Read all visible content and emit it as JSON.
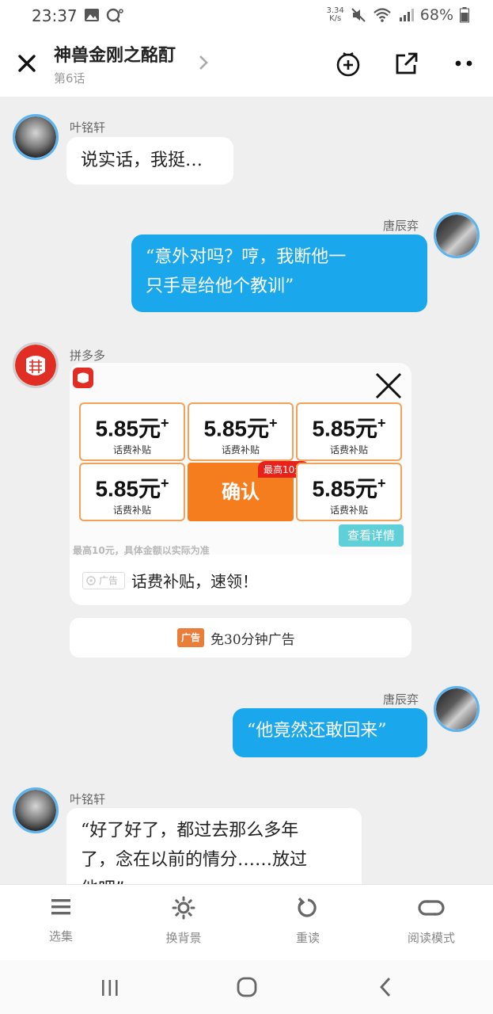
{
  "status_bar": {
    "time": "23:37",
    "speed_top": "3.34",
    "speed_bottom": "K/s",
    "battery": "68%"
  },
  "nav": {
    "title": "神兽金刚之酩酊",
    "subtitle": "第6话"
  },
  "messages": [
    {
      "speaker": "叶铭轩",
      "side": "left",
      "text": "说实话，我挺…"
    },
    {
      "speaker": "唐辰弈",
      "side": "right",
      "lines": [
        "“意外对吗？哼，我断他一",
        "只手是给他个教训”"
      ]
    },
    {
      "speaker": "唐辰弈",
      "side": "right",
      "text": "“他竟然还敢回来”"
    },
    {
      "speaker": "叶铭轩",
      "side": "left",
      "lines": [
        "“好了好了，都过去那么多年",
        "了，念在以前的情分……放过",
        "他吧”"
      ]
    }
  ],
  "ad": {
    "sender": "拼多多",
    "coupons": [
      {
        "amount": "5.85元",
        "plus": "+",
        "label": "话费补贴"
      },
      {
        "amount": "5.85元",
        "plus": "+",
        "label": "话费补贴"
      },
      {
        "amount": "5.85元",
        "plus": "+",
        "label": "话费补贴"
      },
      {
        "amount": "5.85元",
        "plus": "+",
        "label": "话费补贴"
      },
      {
        "amount": "5.85元",
        "plus": "+",
        "label": "话费补贴"
      }
    ],
    "confirm_label": "确认",
    "max_badge": "最高10元",
    "details_label": "查看详情",
    "note": "最高10元，具体金额以实际为准",
    "tag": "广告",
    "text": "话费补贴，速领！",
    "free_ad_label": "免30分钟广告",
    "free_ad_icon_text": "广告"
  },
  "toolbar": [
    {
      "label": "选集",
      "icon": "list-icon"
    },
    {
      "label": "换背景",
      "icon": "background-icon"
    },
    {
      "label": "重读",
      "icon": "reload-icon"
    },
    {
      "label": "阅读模式",
      "icon": "read-mode-icon"
    }
  ],
  "colors": {
    "bubble_right": "#1aa7ec",
    "accent_orange": "#f57d1e",
    "avatar_ring": "#5bb3ef",
    "pdd_red": "#e02e24"
  }
}
